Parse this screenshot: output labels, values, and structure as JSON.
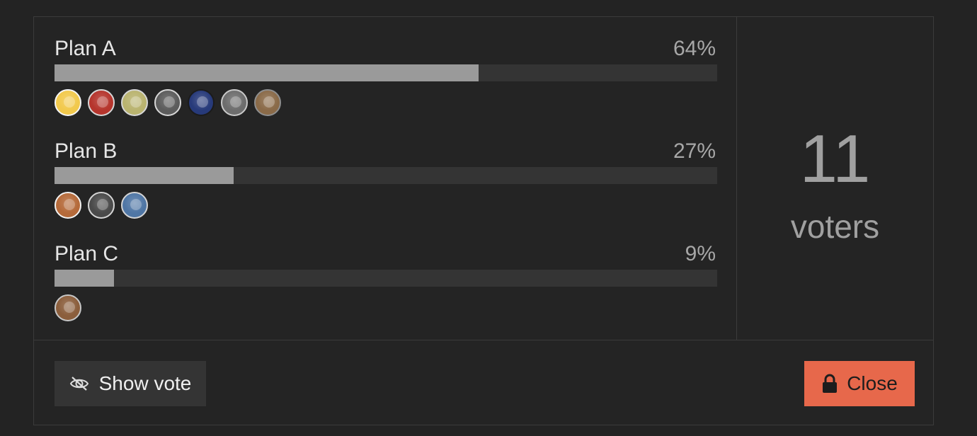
{
  "poll": {
    "options": [
      {
        "name": "Plan A",
        "percent_label": "64%",
        "percent": 64,
        "voters": [
          {
            "icon": "avatar-cartoon-man",
            "bg": "#f2c94c",
            "ring": "#f5f5f5"
          },
          {
            "icon": "avatar-red-suit",
            "bg": "#b6352d",
            "ring": "#d7d7d7"
          },
          {
            "icon": "avatar-blonde-character",
            "bg": "#b9b36f",
            "ring": "#d7d7d7"
          },
          {
            "icon": "avatar-woman-portrait",
            "bg": "#5c5c5c",
            "ring": "#d7d7d7"
          },
          {
            "icon": "avatar-blue-figure",
            "bg": "#273a7a",
            "ring": "#1b1b1b"
          },
          {
            "icon": "avatar-dark-silhouette",
            "bg": "#6d6d6d",
            "ring": "#c9c9c9"
          },
          {
            "icon": "avatar-anime-boy",
            "bg": "#8a6a48",
            "ring": "#8e8e8e"
          }
        ]
      },
      {
        "name": "Plan B",
        "percent_label": "27%",
        "percent": 27,
        "voters": [
          {
            "icon": "avatar-cartoon-face",
            "bg": "#b56a3a",
            "ring": "#f2f2f2"
          },
          {
            "icon": "avatar-statue",
            "bg": "#4a4a4a",
            "ring": "#d5d5d5"
          },
          {
            "icon": "avatar-blue-scene",
            "bg": "#4f76a5",
            "ring": "#d5d5d5"
          }
        ]
      },
      {
        "name": "Plan C",
        "percent_label": "9%",
        "percent": 9,
        "voters": [
          {
            "icon": "avatar-brown-texture",
            "bg": "#8b5e3c",
            "ring": "#c7c7c7"
          }
        ]
      }
    ],
    "total_voters": "11",
    "voters_label": "voters",
    "show_vote_label": "Show vote",
    "close_label": "Close",
    "colors": {
      "bar_fill": "#9a9a9a",
      "bar_track": "#343434",
      "close_button": "#e7684b"
    }
  }
}
